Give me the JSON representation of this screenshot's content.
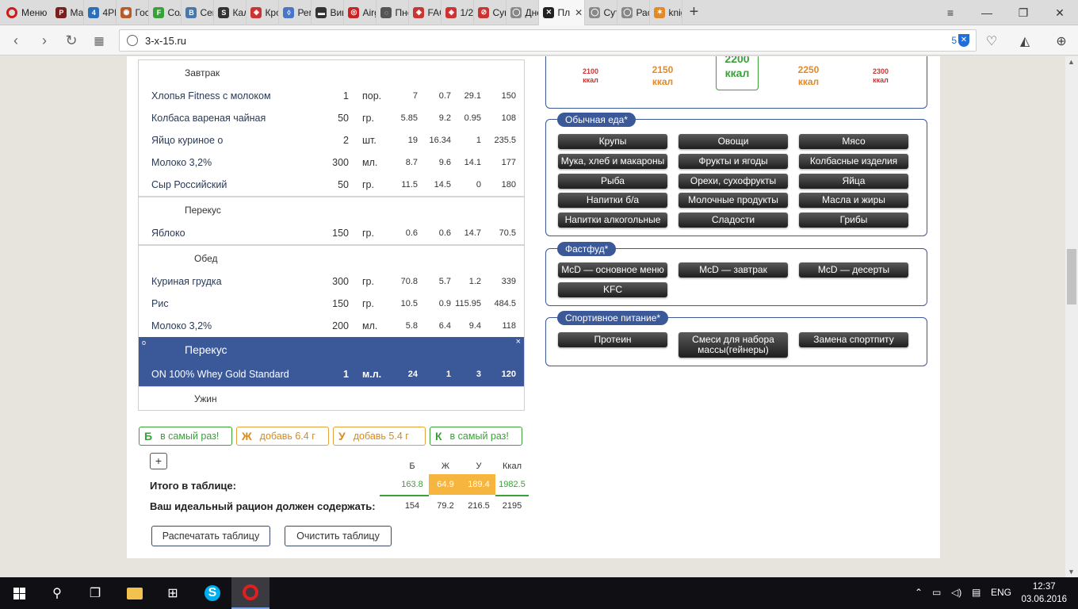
{
  "browser": {
    "menu_label": "Меню",
    "tabs": [
      {
        "label": "Мар",
        "color": "#7a1f1f",
        "glyph": "P"
      },
      {
        "label": "4PD",
        "color": "#2a6fb8",
        "glyph": "4"
      },
      {
        "label": "Госа",
        "color": "#b85a2a",
        "glyph": "◉"
      },
      {
        "label": "Сол",
        "color": "#3aa13a",
        "glyph": "F"
      },
      {
        "label": "Сем",
        "color": "#4a76a8",
        "glyph": "B"
      },
      {
        "label": "Кал",
        "color": "#333333",
        "glyph": "S"
      },
      {
        "label": "Кро",
        "color": "#cc3333",
        "glyph": "◈"
      },
      {
        "label": "Рем",
        "color": "#4a76c8",
        "glyph": "◊"
      },
      {
        "label": "Вин",
        "color": "#333333",
        "glyph": "▬"
      },
      {
        "label": "Airg",
        "color": "#cc2222",
        "glyph": "◎"
      },
      {
        "label": "Пне",
        "color": "#555555",
        "glyph": "◌"
      },
      {
        "label": "FAQ",
        "color": "#cc3333",
        "glyph": "◈"
      },
      {
        "label": "1/2",
        "color": "#cc3333",
        "glyph": "◈"
      },
      {
        "label": "Суп",
        "color": "#cc3333",
        "glyph": "⊘"
      },
      {
        "label": "Дне",
        "color": "#888888",
        "glyph": "◯"
      },
      {
        "label": "Пл",
        "color": "#222222",
        "glyph": "✕",
        "active": true
      },
      {
        "label": "Сут",
        "color": "#888888",
        "glyph": "◯"
      },
      {
        "label": "Рас",
        "color": "#888888",
        "glyph": "◯"
      },
      {
        "label": "knig",
        "color": "#e38a28",
        "glyph": "✶"
      }
    ],
    "url": "3-x-15.ru",
    "shield_count": "5"
  },
  "kcal_options": [
    {
      "value": "2100",
      "unit": "ккал",
      "size": "s"
    },
    {
      "value": "2150",
      "unit": "ккал",
      "size": "m"
    },
    {
      "value": "2200",
      "unit": "ккал",
      "size": "sel"
    },
    {
      "value": "2250",
      "unit": "ккал",
      "size": "m"
    },
    {
      "value": "2300",
      "unit": "ккал",
      "size": "s"
    }
  ],
  "meals": {
    "breakfast": {
      "title": "Завтрак",
      "rows": [
        {
          "name": "Хлопья Fitness с молоком",
          "qty": "1",
          "unit": "пор.",
          "p": "7",
          "f": "0.7",
          "c": "29.1",
          "kcal": "150"
        },
        {
          "name": "Колбаса вареная чайная",
          "qty": "50",
          "unit": "гр.",
          "p": "5.85",
          "f": "9.2",
          "c": "0.95",
          "kcal": "108"
        },
        {
          "name": "Яйцо куриное о",
          "qty": "2",
          "unit": "шт.",
          "p": "19",
          "f": "16.34",
          "c": "1",
          "kcal": "235.5"
        },
        {
          "name": "Молоко 3,2%",
          "qty": "300",
          "unit": "мл.",
          "p": "8.7",
          "f": "9.6",
          "c": "14.1",
          "kcal": "177"
        },
        {
          "name": "Сыр Российский",
          "qty": "50",
          "unit": "гр.",
          "p": "11.5",
          "f": "14.5",
          "c": "0",
          "kcal": "180"
        }
      ]
    },
    "snack1": {
      "title": "Перекус",
      "rows": [
        {
          "name": "Яблоко",
          "qty": "150",
          "unit": "гр.",
          "p": "0.6",
          "f": "0.6",
          "c": "14.7",
          "kcal": "70.5"
        }
      ]
    },
    "lunch": {
      "title": "Обед",
      "rows": [
        {
          "name": "Куриная грудка",
          "qty": "300",
          "unit": "гр.",
          "p": "70.8",
          "f": "5.7",
          "c": "1.2",
          "kcal": "339"
        },
        {
          "name": "Рис",
          "qty": "150",
          "unit": "гр.",
          "p": "10.5",
          "f": "0.9",
          "c": "115.95",
          "kcal": "484.5"
        },
        {
          "name": "Молоко 3,2%",
          "qty": "200",
          "unit": "мл.",
          "p": "5.8",
          "f": "6.4",
          "c": "9.4",
          "kcal": "118"
        }
      ]
    },
    "snack2": {
      "title": "Перекус",
      "circle": "o",
      "close": "×",
      "row": {
        "name": "ON 100% Whey Gold Standard",
        "qty": "1",
        "unit": "м.л.",
        "p": "24",
        "f": "1",
        "c": "3",
        "kcal": "120"
      }
    },
    "dinner": {
      "title": "Ужин"
    }
  },
  "badges": [
    {
      "letter": "Б",
      "text": "в самый раз!",
      "tone": "g"
    },
    {
      "letter": "Ж",
      "text": "добавь 6.4 г",
      "tone": "o"
    },
    {
      "letter": "У",
      "text": "добавь 5.4 г",
      "tone": "o"
    },
    {
      "letter": "К",
      "text": "в самый раз!",
      "tone": "g"
    }
  ],
  "totals": {
    "plus": "+",
    "headers": [
      "Б",
      "Ж",
      "У",
      "Ккал"
    ],
    "table_label": "Итого в таблице:",
    "table_values": [
      "163.8",
      "64.9",
      "189.4",
      "1982.5"
    ],
    "ideal_label": "Ваш идеальный рацион должен содержать:",
    "ideal_values": [
      "154",
      "79.2",
      "216.5",
      "2195"
    ],
    "print_button": "Распечатать таблицу",
    "clear_button": "Очистить таблицу"
  },
  "groups": {
    "regular": {
      "title": "Обычная еда*",
      "items": [
        "Крупы",
        "Овощи",
        "Мясо",
        "Мука, хлеб и макароны",
        "Фрукты и ягоды",
        "Колбасные изделия",
        "Рыба",
        "Орехи, сухофрукты",
        "Яйца",
        "Напитки б/а",
        "Молочные продукты",
        "Масла и жиры",
        "Напитки алкогольные",
        "Сладости",
        "Грибы"
      ]
    },
    "fastfood": {
      "title": "Фастфуд*",
      "items": [
        "McD — основное меню",
        "McD — завтрак",
        "McD — десерты",
        "KFC"
      ]
    },
    "sport": {
      "title": "Спортивное питание*",
      "items": [
        "Протеин",
        "Смеси для набора массы(гейнеры)",
        "Замена спортпиту"
      ]
    }
  },
  "taskbar": {
    "lang": "ENG",
    "time": "12:37",
    "date": "03.06.2016"
  }
}
